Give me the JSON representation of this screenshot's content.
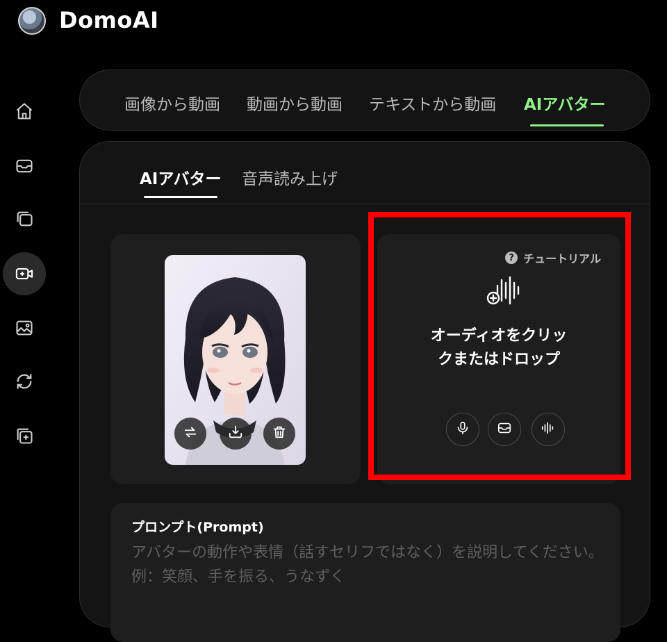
{
  "app": {
    "name": "DomoAI"
  },
  "sidebar": {
    "items": [
      {
        "icon": "home-icon"
      },
      {
        "icon": "inbox-icon"
      },
      {
        "icon": "gallery-icon"
      },
      {
        "icon": "video-add-icon",
        "active": true
      },
      {
        "icon": "image-icon"
      },
      {
        "icon": "refresh-icon"
      },
      {
        "icon": "add-layer-icon"
      }
    ]
  },
  "main_tabs": [
    {
      "label": "画像から動画"
    },
    {
      "label": "動画から動画"
    },
    {
      "label": "テキストから動画"
    },
    {
      "label": "AIアバター",
      "active": true
    }
  ],
  "sub_tabs": [
    {
      "label": "AIアバター",
      "active": true
    },
    {
      "label": "音声読み上げ"
    }
  ],
  "image_card": {
    "buttons": [
      {
        "icon": "swap-icon"
      },
      {
        "icon": "download-icon"
      },
      {
        "icon": "trash-icon"
      }
    ]
  },
  "audio_card": {
    "tutorial_label": "チュートリアル",
    "drop_text": "オーディオをクリックまたはドロップ",
    "buttons": [
      {
        "icon": "microphone-icon"
      },
      {
        "icon": "inbox-icon"
      },
      {
        "icon": "waveform-icon"
      }
    ]
  },
  "prompt": {
    "label": "プロンプト(Prompt)",
    "placeholder": "アバターの動作や表情（話すセリフではなく）を説明してください。例：笑顔、手を振る、うなずく"
  },
  "colors": {
    "accent": "#8ff08a",
    "highlight": "#ff0000",
    "background": "#000000"
  }
}
